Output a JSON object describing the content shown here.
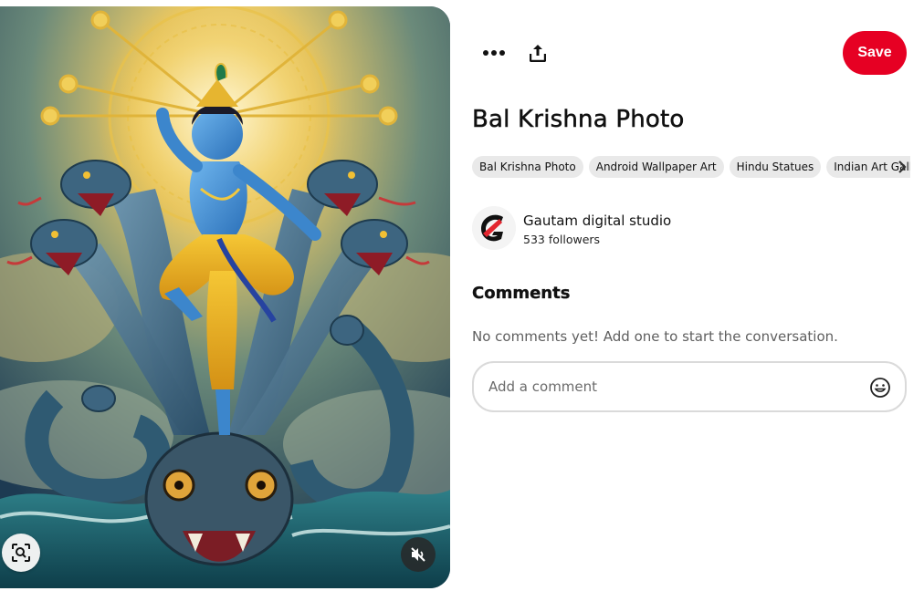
{
  "pin": {
    "image_alt": "Bal Krishna dancing on the multi-headed serpent",
    "title": "Bal Krishna Photo"
  },
  "toolbar": {
    "more_icon": "more-horizontal-icon",
    "share_icon": "share-icon",
    "save_label": "Save"
  },
  "tags": [
    "Bal Krishna Photo",
    "Android Wallpaper Art",
    "Hindu Statues",
    "Indian Art Gallery"
  ],
  "creator": {
    "name": "Gautam digital studio",
    "followers": "533 followers"
  },
  "comments": {
    "heading": "Comments",
    "empty_text": "No comments yet! Add one to start the conversation.",
    "input_placeholder": "Add a comment"
  },
  "colors": {
    "save_button": "#e60023",
    "tag_background": "#e9e9e9"
  }
}
